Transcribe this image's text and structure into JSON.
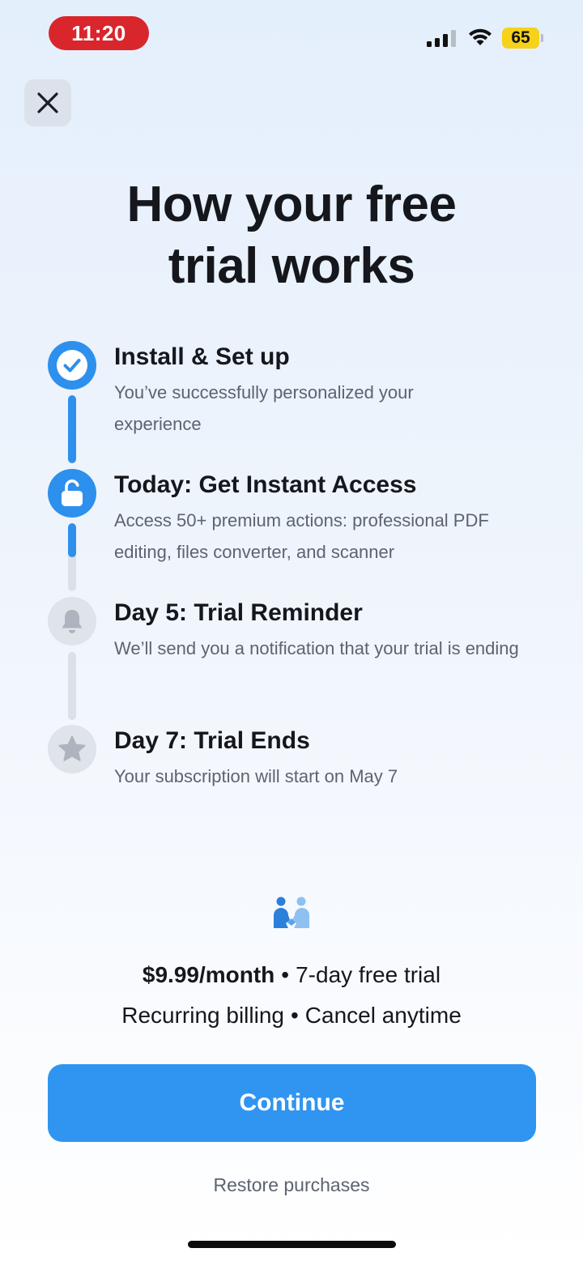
{
  "status_bar": {
    "time": "11:20",
    "battery": "65",
    "icons": [
      "cellular-signal-icon",
      "wifi-icon",
      "battery-icon"
    ]
  },
  "close_icon": "close-icon",
  "title_line1": "How your free",
  "title_line2": "trial works",
  "steps": [
    {
      "title": "Install & Set up",
      "desc": "You’ve successfully personalized your experience",
      "icon": "checkmark-icon",
      "status": "completed"
    },
    {
      "title": "Today: Get Instant Access",
      "desc": "Access 50+ premium actions: professional PDF editing, files converter, and scanner",
      "icon": "unlock-icon",
      "status": "current"
    },
    {
      "title": "Day 5: Trial Reminder",
      "desc": "We’ll send you a notification that your trial is ending",
      "icon": "bell-icon",
      "status": "upcoming"
    },
    {
      "title": "Day 7: Trial Ends",
      "desc": "Your subscription will start on May 7",
      "icon": "star-icon",
      "status": "upcoming"
    }
  ],
  "progress": {
    "connector_1_fill": 1.0,
    "connector_2_fill": 0.5,
    "connector_3_fill": 0.0
  },
  "pricing": {
    "price": "$9.99/month",
    "trial": "7-day free trial",
    "billing": "Recurring billing",
    "cancel": "Cancel anytime",
    "separator": "•"
  },
  "continue_label": "Continue",
  "restore_label": "Restore purchases",
  "colors": {
    "accent": "#2f95f1",
    "step_active": "#2d90ec",
    "step_inactive": "#dfe3ea",
    "time_pill": "#d9252c",
    "battery": "#f6d21b"
  }
}
